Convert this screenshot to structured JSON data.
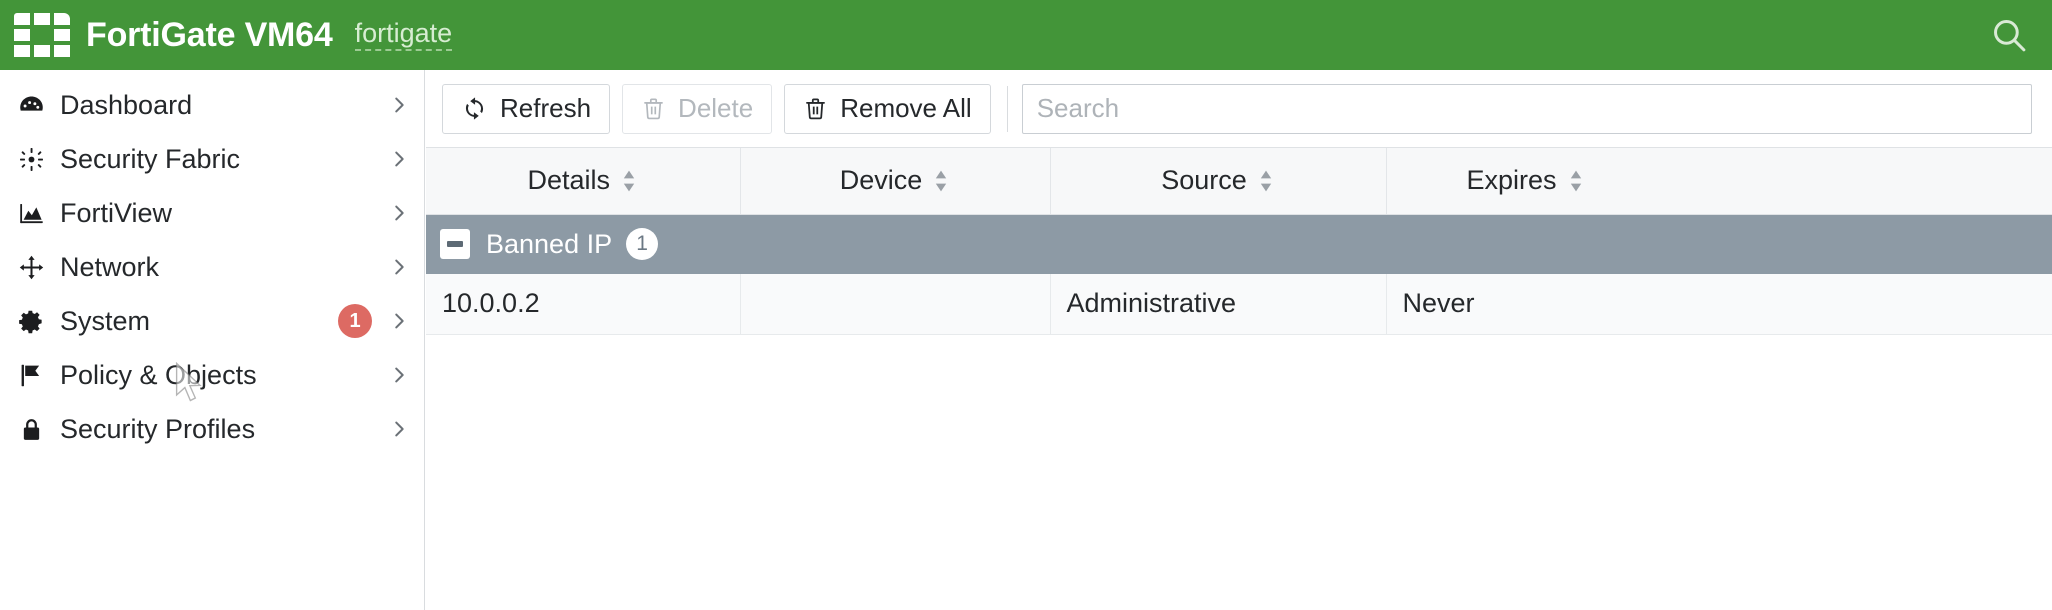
{
  "header": {
    "logo_icon": "fortinet-grid-logo-icon",
    "title": "FortiGate VM64",
    "hostname": "fortigate",
    "search_icon": "search-icon",
    "background_color": "#439539"
  },
  "sidebar": {
    "items": [
      {
        "label": "Dashboard",
        "icon": "dashboard-gauge-icon",
        "chevron": "chevron-right-icon",
        "badge": null
      },
      {
        "label": "Security Fabric",
        "icon": "security-fabric-icon",
        "chevron": "chevron-right-icon",
        "badge": null
      },
      {
        "label": "FortiView",
        "icon": "chart-area-icon",
        "chevron": "chevron-right-icon",
        "badge": null
      },
      {
        "label": "Network",
        "icon": "arrows-move-icon",
        "chevron": "chevron-right-icon",
        "badge": null
      },
      {
        "label": "System",
        "icon": "gear-icon",
        "chevron": "chevron-right-icon",
        "badge": "1"
      },
      {
        "label": "Policy & Objects",
        "icon": "policy-flag-icon",
        "chevron": "chevron-right-icon",
        "badge": null
      },
      {
        "label": "Security Profiles",
        "icon": "lock-icon",
        "chevron": "chevron-right-icon",
        "badge": null
      }
    ],
    "badge_color": "#dd6a63"
  },
  "toolbar": {
    "refresh_label": "Refresh",
    "refresh_icon": "refresh-icon",
    "delete_label": "Delete",
    "delete_icon": "trash-icon",
    "delete_disabled": true,
    "remove_all_label": "Remove All",
    "remove_all_icon": "trash-icon",
    "search_placeholder": "Search",
    "search_value": ""
  },
  "table": {
    "columns": [
      {
        "label": "Details",
        "sort_icon": "sort-updown-icon"
      },
      {
        "label": "Device",
        "sort_icon": "sort-updown-icon"
      },
      {
        "label": "Source",
        "sort_icon": "sort-updown-icon"
      },
      {
        "label": "Expires",
        "sort_icon": "sort-updown-icon"
      }
    ],
    "group": {
      "label": "Banned IP",
      "count": "1",
      "collapse_icon": "collapse-minus-icon",
      "background_color": "#8d9aa5"
    },
    "rows": [
      {
        "details": "10.0.0.2",
        "device": "",
        "source": "Administrative",
        "expires": "Never"
      }
    ]
  },
  "cursor": {
    "icon": "mouse-cursor-icon"
  }
}
